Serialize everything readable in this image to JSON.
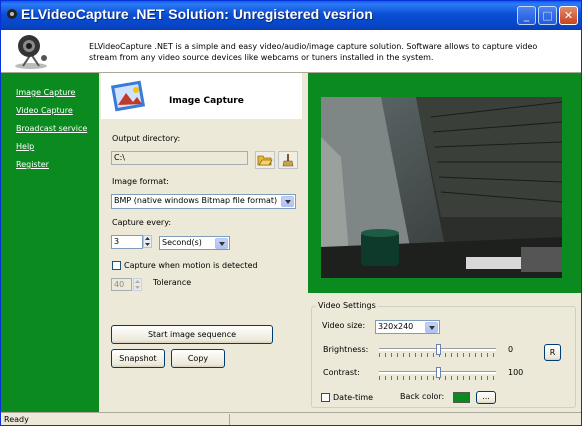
{
  "window": {
    "title": "ELVideoCapture .NET Solution: Unregistered vesrion"
  },
  "titlebar_buttons": {
    "minimize": "_",
    "maximize": "□",
    "close": "✕"
  },
  "header": {
    "description": "ELVideoCapture .NET is a simple and easy video/audio/image capture solution. Software allows to capture video stream from any video source devices like webcams or tuners installed in the system."
  },
  "sidebar": {
    "items": [
      "Image Capture",
      "Video Capture",
      "Broadcast service",
      "Help",
      "Register"
    ]
  },
  "section": {
    "title": "Image Capture"
  },
  "form": {
    "output_dir_label": "Output directory:",
    "output_dir_value": "C:\\",
    "image_format_label": "Image format:",
    "image_format_value": "BMP (native windows Bitmap file format)",
    "capture_every_label": "Capture every:",
    "capture_every_value": "3",
    "capture_unit": "Second(s)",
    "motion_label": "Capture when motion is detected",
    "motion_checked": false,
    "tolerance_value": "40",
    "tolerance_label": "Tolerance"
  },
  "buttons": {
    "start": "Start image sequence",
    "snapshot": "Snapshot",
    "copy": "Copy"
  },
  "video_settings": {
    "title": "Video Settings",
    "video_size_label": "Video size:",
    "video_size_value": "320x240",
    "brightness_label": "Brightness:",
    "brightness_value": "0",
    "brightness_level": 0.5,
    "contrast_label": "Contrast:",
    "contrast_value": "100",
    "contrast_level": 0.5,
    "reset_label": "R",
    "datetime_label": "Date-time",
    "datetime_checked": false,
    "back_color_label": "Back color:",
    "back_color": "#0b8a1f",
    "browse_label": "..."
  },
  "status": {
    "text": "Ready"
  },
  "colors": {
    "sidebar": "#0b8a1f",
    "title_bar": "#0b4fd6"
  }
}
